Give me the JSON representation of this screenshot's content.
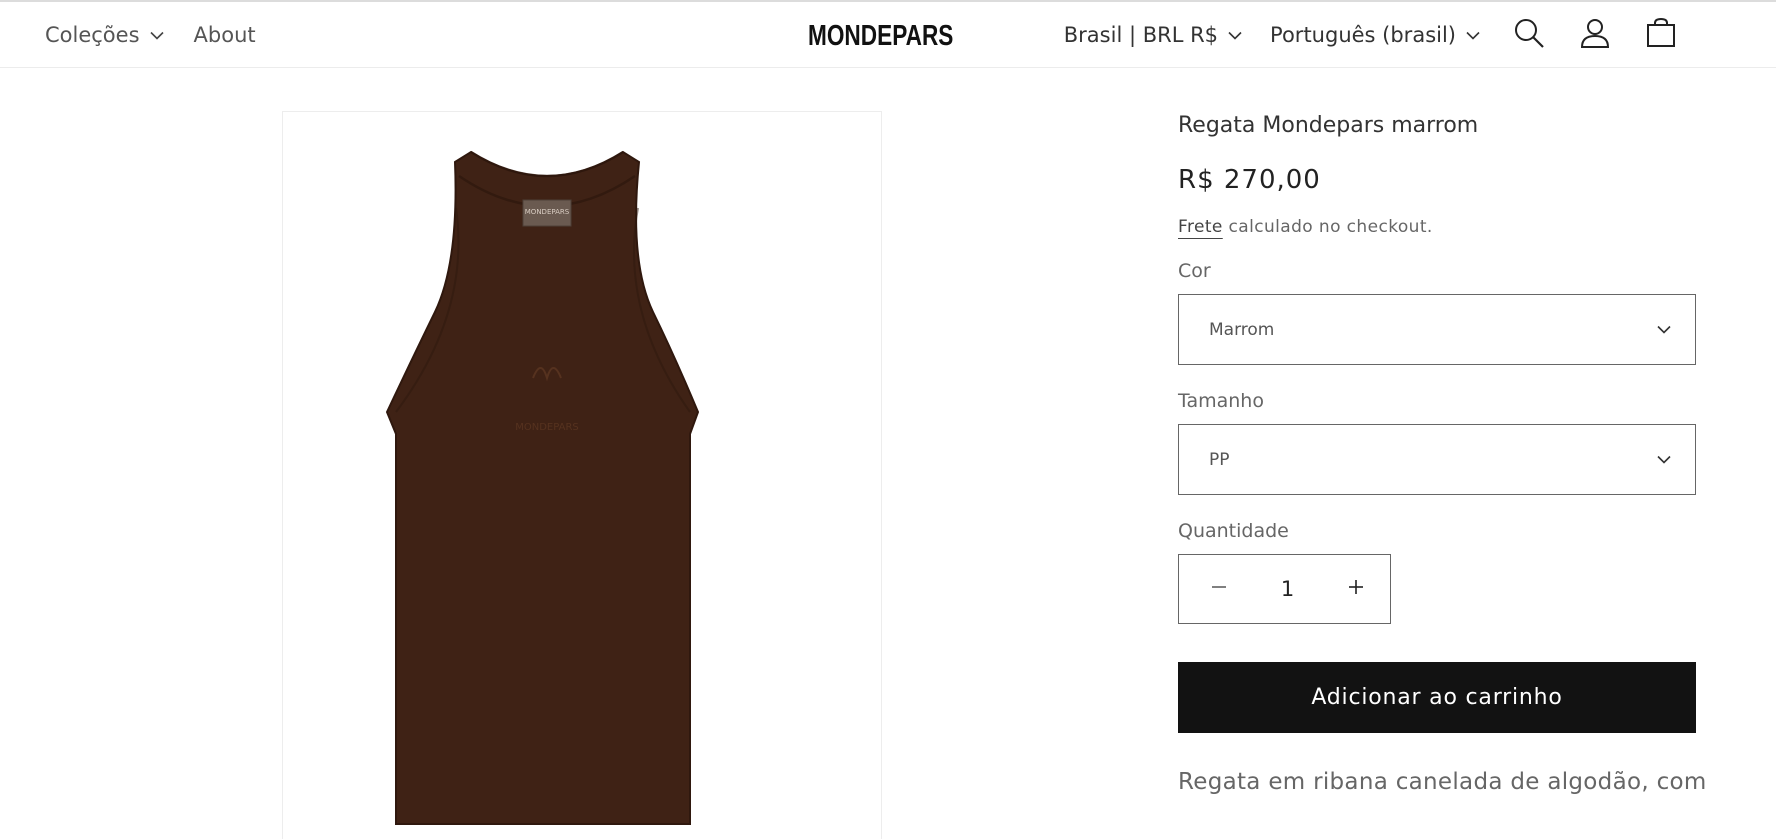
{
  "header": {
    "nav": [
      {
        "label": "Coleções",
        "has_dropdown": true
      },
      {
        "label": "About",
        "has_dropdown": false
      }
    ],
    "logo": "MONDEPARS",
    "country": "Brasil | BRL R$",
    "language": "Português (brasil)",
    "icons": [
      "search-icon",
      "account-icon",
      "cart-icon"
    ]
  },
  "product": {
    "title": "Regata Mondepars marrom",
    "price": "R$ 270,00",
    "shipping_link": "Frete",
    "shipping_text": " calculado no checkout.",
    "color_label": "Cor",
    "color_value": "Marrom",
    "size_label": "Tamanho",
    "size_value": "PP",
    "quantity_label": "Quantidade",
    "quantity": "1",
    "add_to_cart": "Adicionar ao carrinho",
    "description": "Regata em ribana canelada de algodão, com",
    "image_color": "#3f2215",
    "image_tag_text": "MONDEPARS",
    "image_embroidery_text": "MONDEPARS"
  }
}
